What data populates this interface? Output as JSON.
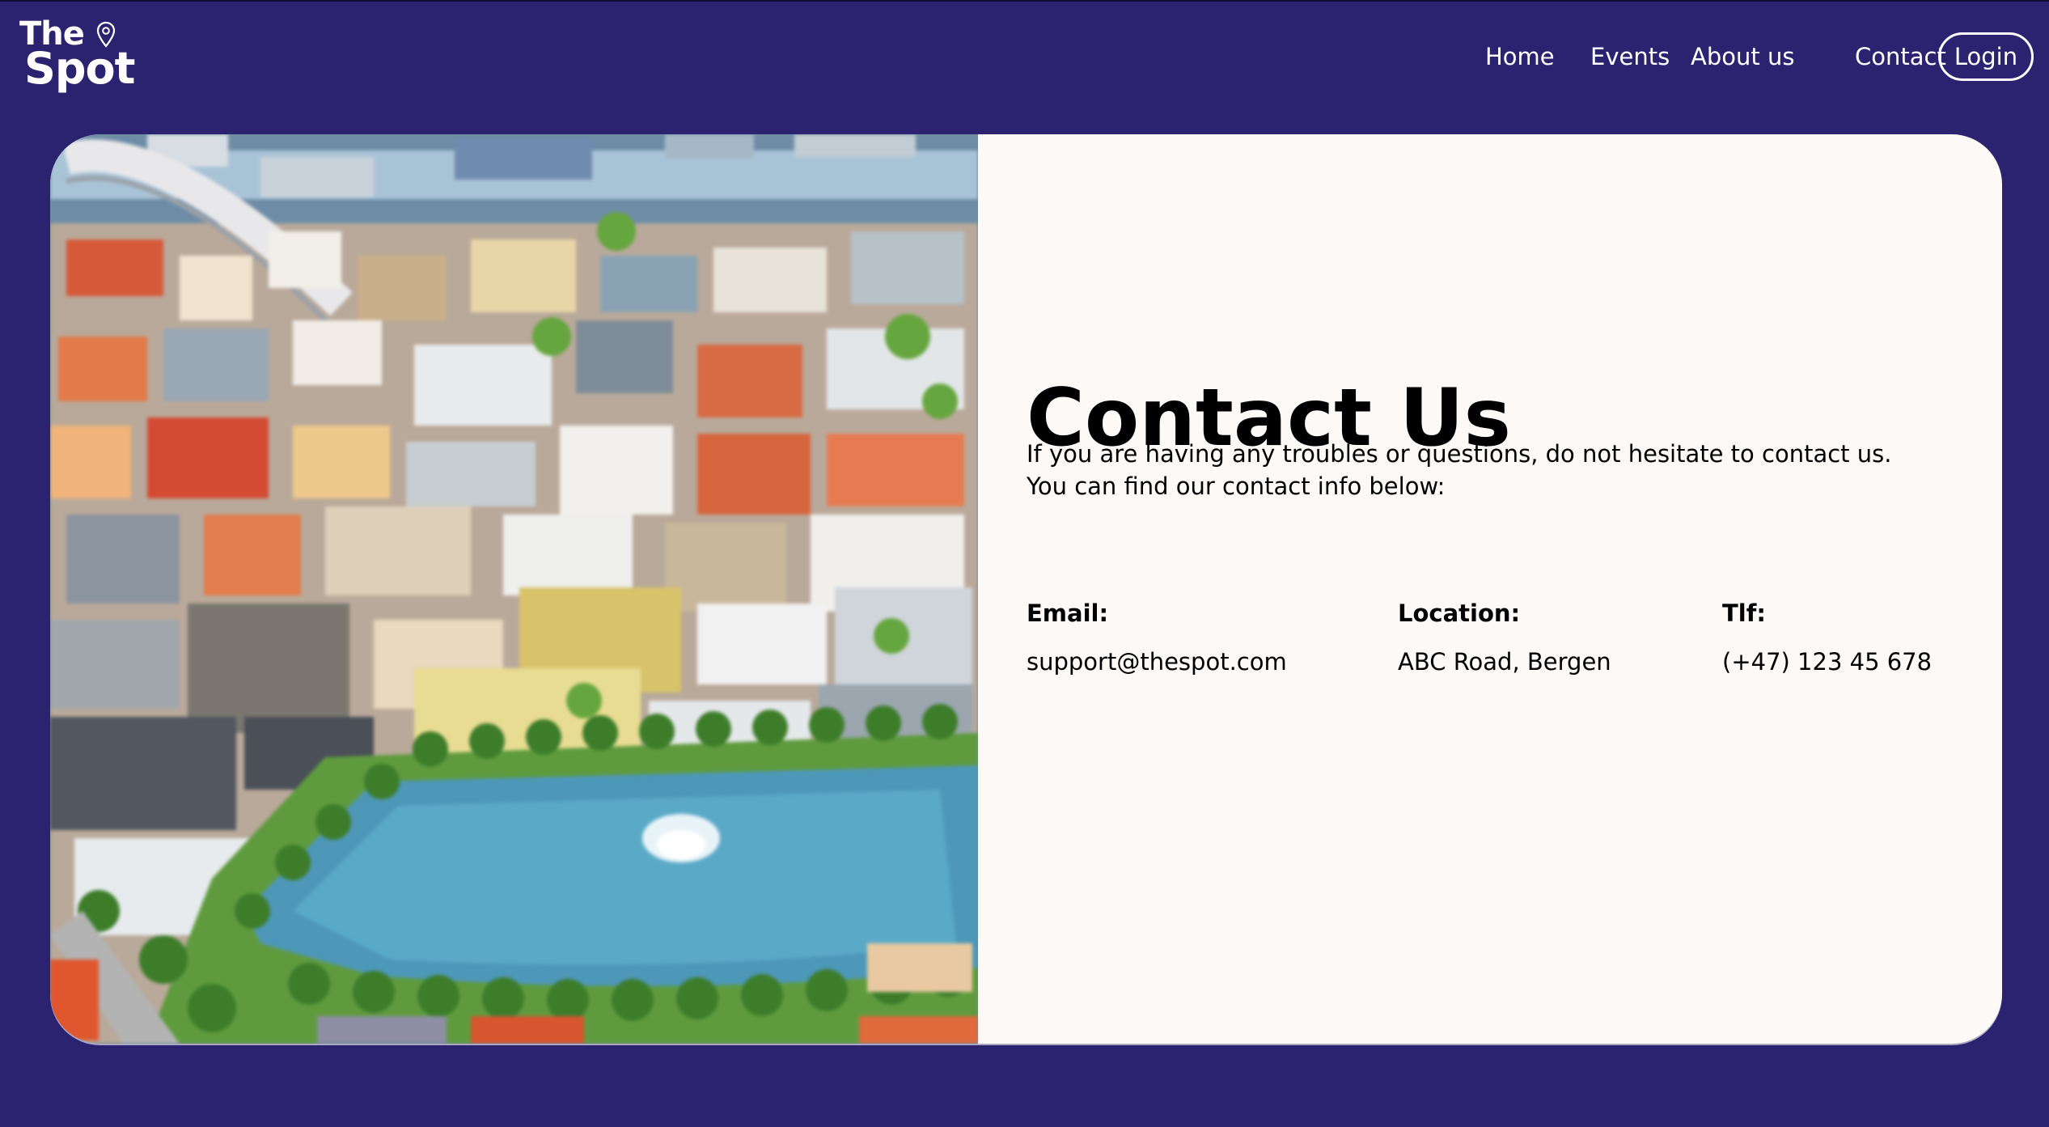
{
  "brand": {
    "line1": "The",
    "line2": "Spot",
    "icon": "location-pin-icon"
  },
  "nav": {
    "items": [
      {
        "label": "Home"
      },
      {
        "label": "Events"
      },
      {
        "label": "About us"
      },
      {
        "label": "Contact"
      }
    ],
    "login_label": "Login"
  },
  "hero": {
    "image": "aerial-city-lake-photo"
  },
  "contact": {
    "title": "Contact Us",
    "intro": "If you are having any troubles or questions, do not hesitate to contact us. You can find our contact info below:",
    "email": {
      "label": "Email:",
      "value": "support@thespot.com"
    },
    "location": {
      "label": "Location:",
      "value": "ABC Road, Bergen"
    },
    "phone": {
      "label": "Tlf:",
      "value": "(+47) 123 45 678"
    }
  },
  "colors": {
    "background": "#2b236f",
    "card": "#fcf9f6",
    "text": "#000000",
    "nav_text": "#ffffff"
  }
}
